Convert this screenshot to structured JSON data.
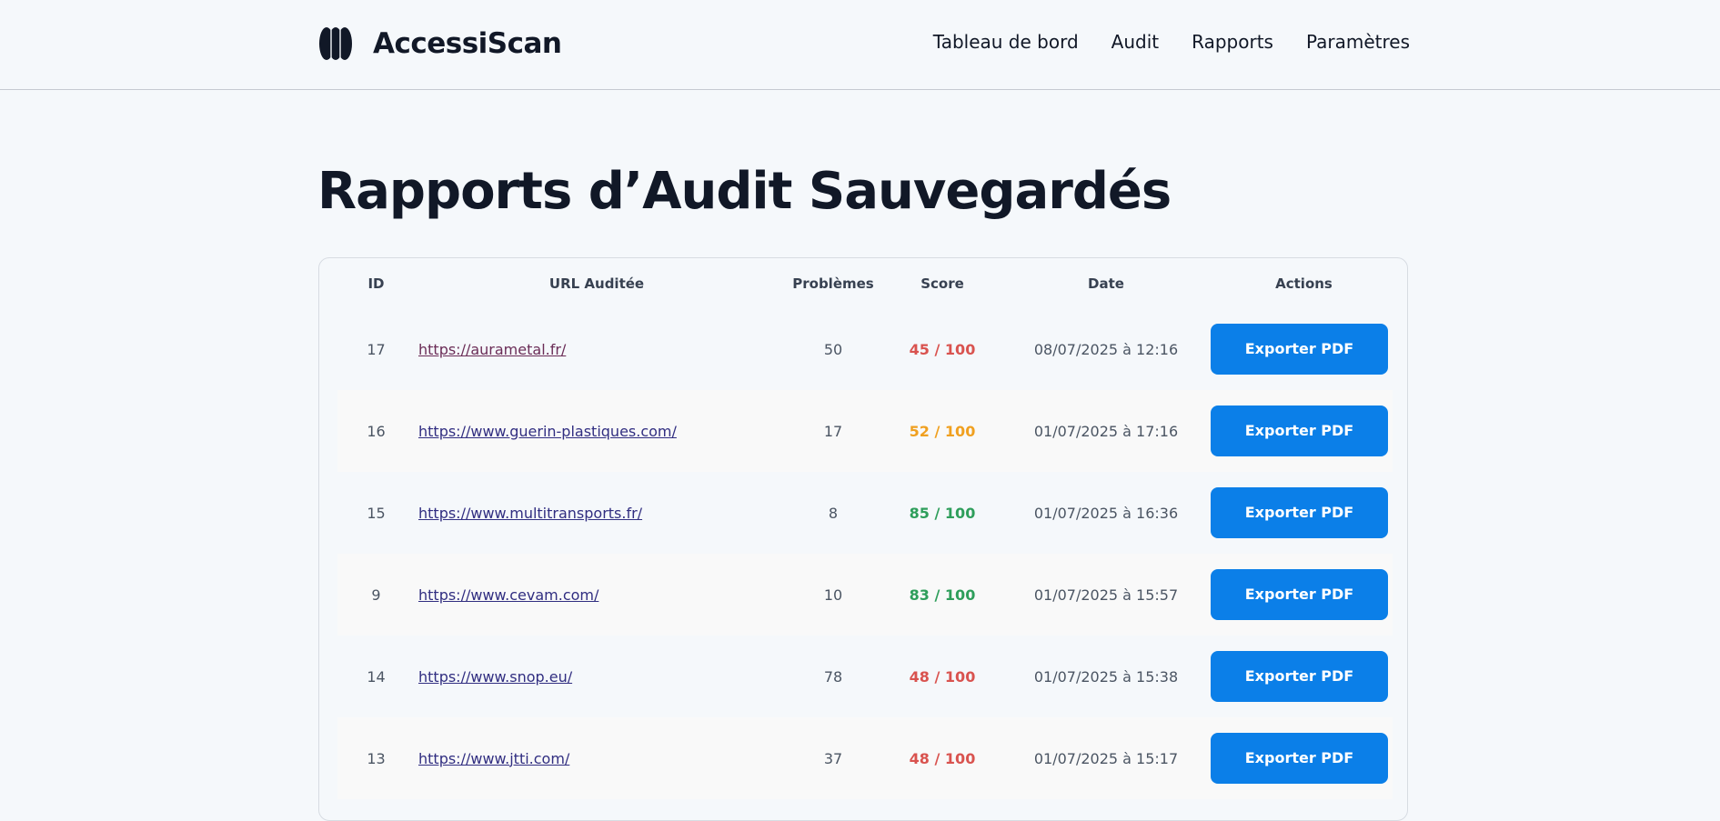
{
  "header": {
    "brand": "AccessiScan",
    "nav": [
      "Tableau de bord",
      "Audit",
      "Rapports",
      "Paramètres"
    ]
  },
  "page": {
    "title": "Rapports d’Audit Sauvegardés"
  },
  "table": {
    "columns": [
      "ID",
      "URL Auditée",
      "Problèmes",
      "Score",
      "Date",
      "Actions"
    ],
    "rows": [
      {
        "id": "17",
        "url": "https://aurametal.fr/",
        "issues": "50",
        "score": "45 / 100",
        "score_color": "#d9534f",
        "date": "08/07/2025 à 12:16",
        "action": "Exporter PDF"
      },
      {
        "id": "16",
        "url": "https://www.guerin-plastiques.com/",
        "issues": "17",
        "score": "52 / 100",
        "score_color": "#f0a020",
        "date": "01/07/2025 à 17:16",
        "action": "Exporter PDF"
      },
      {
        "id": "15",
        "url": "https://www.multitransports.fr/",
        "issues": "8",
        "score": "85 / 100",
        "score_color": "#2e9e5b",
        "date": "01/07/2025 à 16:36",
        "action": "Exporter PDF"
      },
      {
        "id": "9",
        "url": "https://www.cevam.com/",
        "issues": "10",
        "score": "83 / 100",
        "score_color": "#2e9e5b",
        "date": "01/07/2025 à 15:57",
        "action": "Exporter PDF"
      },
      {
        "id": "14",
        "url": "https://www.snop.eu/",
        "issues": "78",
        "score": "48 / 100",
        "score_color": "#d9534f",
        "date": "01/07/2025 à 15:38",
        "action": "Exporter PDF"
      },
      {
        "id": "13",
        "url": "https://www.jtti.com/",
        "issues": "37",
        "score": "48 / 100",
        "score_color": "#d9534f",
        "date": "01/07/2025 à 15:17",
        "action": "Exporter PDF"
      }
    ]
  },
  "colors": {
    "accent": "#0b7fe8",
    "link": "#312e81",
    "visited_link": "#6b2d57",
    "score_low": "#d9534f",
    "score_mid": "#f0a020",
    "score_high": "#2e9e5b"
  }
}
